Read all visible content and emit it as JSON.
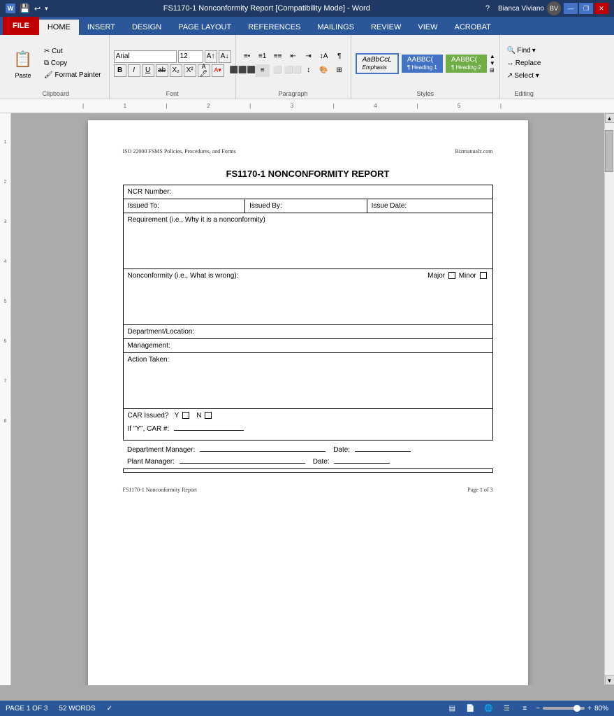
{
  "titlebar": {
    "title": "FS1170-1 Nonconformity Report [Compatibility Mode] - Word",
    "help_icon": "?",
    "minimize": "—",
    "restore": "❐",
    "close": "✕"
  },
  "quickaccess": {
    "save_label": "💾",
    "undo_label": "↩",
    "redo_label": "↪"
  },
  "ribbon": {
    "tabs": [
      "FILE",
      "HOME",
      "INSERT",
      "DESIGN",
      "PAGE LAYOUT",
      "REFERENCES",
      "MAILINGS",
      "REVIEW",
      "VIEW",
      "ACROBAT"
    ],
    "active_tab": "HOME",
    "file_tab": "FILE",
    "groups": {
      "clipboard": {
        "label": "Clipboard",
        "paste_label": "Paste",
        "cut_label": "Cut",
        "copy_label": "Copy",
        "format_painter_label": "Format Painter"
      },
      "font": {
        "label": "Font",
        "font_name": "Arial",
        "font_size": "12",
        "bold": "B",
        "italic": "I",
        "underline": "U"
      },
      "paragraph": {
        "label": "Paragraph"
      },
      "styles": {
        "label": "Styles",
        "items": [
          "Emphasis",
          "¶ Heading 1",
          "¶ Heading 2"
        ]
      },
      "editing": {
        "label": "Editing",
        "find_label": "Find",
        "replace_label": "Replace",
        "select_label": "Select"
      }
    }
  },
  "document": {
    "header_left": "ISO 22000 FSMS Policies, Procedures, and Forms",
    "header_right": "Bizmanualz.com",
    "title": "FS1170-1 NONCONFORMITY REPORT",
    "form": {
      "ncr_label": "NCR Number:",
      "issued_to_label": "Issued To:",
      "issued_by_label": "Issued By:",
      "issue_date_label": "Issue Date:",
      "requirement_label": "Requirement (i.e., Why it is a nonconformity)",
      "nonconformity_label": "Nonconformity (i.e., What is wrong):",
      "major_label": "Major",
      "minor_label": "Minor",
      "dept_location_label": "Department/Location:",
      "management_label": "Management:",
      "action_taken_label": "Action Taken:",
      "car_issued_label": "CAR Issued?",
      "car_y_label": "Y",
      "car_n_label": "N",
      "if_y_car_label": "If \"Y\", CAR #:",
      "dept_manager_label": "Department Manager:",
      "date_label": "Date:",
      "plant_manager_label": "Plant Manager:",
      "date2_label": "Date:"
    }
  },
  "statusbar": {
    "page_info": "PAGE 1 OF 3",
    "words": "52 WORDS",
    "zoom": "80%"
  },
  "footer_text": "FS1170-1 Nonconformity Report",
  "footer_page": "Page 1 of 3",
  "user": {
    "name": "Bianca Viviano"
  },
  "select_label": "Select ▾"
}
